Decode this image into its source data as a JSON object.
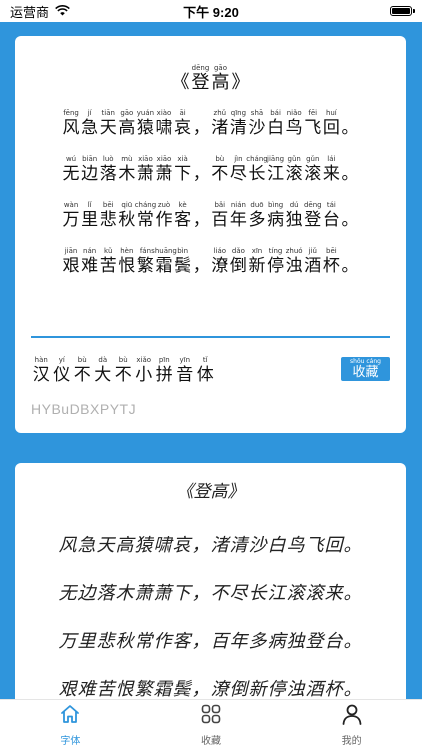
{
  "status_bar": {
    "carrier": "运营商",
    "time": "下午 9:20",
    "battery_level": 0.9
  },
  "poem": {
    "title": [
      {
        "py": "",
        "hz": "《"
      },
      {
        "py": "dēng",
        "hz": "登"
      },
      {
        "py": "gāo",
        "hz": "高"
      },
      {
        "py": "",
        "hz": "》"
      }
    ],
    "lines": [
      [
        {
          "py": "fēng",
          "hz": "风"
        },
        {
          "py": "jí",
          "hz": "急"
        },
        {
          "py": "tiān",
          "hz": "天"
        },
        {
          "py": "gāo",
          "hz": "高"
        },
        {
          "py": "yuán",
          "hz": "猿"
        },
        {
          "py": "xiào",
          "hz": "啸"
        },
        {
          "py": "āi",
          "hz": "哀"
        },
        {
          "py": "",
          "hz": "，"
        },
        {
          "py": "zhǔ",
          "hz": "渚"
        },
        {
          "py": "qīng",
          "hz": "清"
        },
        {
          "py": "shā",
          "hz": "沙"
        },
        {
          "py": "bái",
          "hz": "白"
        },
        {
          "py": "niǎo",
          "hz": "鸟"
        },
        {
          "py": "fēi",
          "hz": "飞"
        },
        {
          "py": "huí",
          "hz": "回"
        },
        {
          "py": "",
          "hz": "。"
        }
      ],
      [
        {
          "py": "wú",
          "hz": "无"
        },
        {
          "py": "biān",
          "hz": "边"
        },
        {
          "py": "luò",
          "hz": "落"
        },
        {
          "py": "mù",
          "hz": "木"
        },
        {
          "py": "xiāo",
          "hz": "萧"
        },
        {
          "py": "xiāo",
          "hz": "萧"
        },
        {
          "py": "xià",
          "hz": "下"
        },
        {
          "py": "",
          "hz": "，"
        },
        {
          "py": "bù",
          "hz": "不"
        },
        {
          "py": "jìn",
          "hz": "尽"
        },
        {
          "py": "cháng",
          "hz": "长"
        },
        {
          "py": "jiāng",
          "hz": "江"
        },
        {
          "py": "gǔn",
          "hz": "滚"
        },
        {
          "py": "gǔn",
          "hz": "滚"
        },
        {
          "py": "lái",
          "hz": "来"
        },
        {
          "py": "",
          "hz": "。"
        }
      ],
      [
        {
          "py": "wàn",
          "hz": "万"
        },
        {
          "py": "lǐ",
          "hz": "里"
        },
        {
          "py": "bēi",
          "hz": "悲"
        },
        {
          "py": "qiū",
          "hz": "秋"
        },
        {
          "py": "cháng",
          "hz": "常"
        },
        {
          "py": "zuò",
          "hz": "作"
        },
        {
          "py": "kè",
          "hz": "客"
        },
        {
          "py": "",
          "hz": "，"
        },
        {
          "py": "bǎi",
          "hz": "百"
        },
        {
          "py": "nián",
          "hz": "年"
        },
        {
          "py": "duō",
          "hz": "多"
        },
        {
          "py": "bìng",
          "hz": "病"
        },
        {
          "py": "dú",
          "hz": "独"
        },
        {
          "py": "dēng",
          "hz": "登"
        },
        {
          "py": "tái",
          "hz": "台"
        },
        {
          "py": "",
          "hz": "。"
        }
      ],
      [
        {
          "py": "jiān",
          "hz": "艰"
        },
        {
          "py": "nán",
          "hz": "难"
        },
        {
          "py": "kǔ",
          "hz": "苦"
        },
        {
          "py": "hèn",
          "hz": "恨"
        },
        {
          "py": "fán",
          "hz": "繁"
        },
        {
          "py": "shuāng",
          "hz": "霜"
        },
        {
          "py": "bìn",
          "hz": "鬓"
        },
        {
          "py": "",
          "hz": "，"
        },
        {
          "py": "liáo",
          "hz": "潦"
        },
        {
          "py": "dǎo",
          "hz": "倒"
        },
        {
          "py": "xīn",
          "hz": "新"
        },
        {
          "py": "tíng",
          "hz": "停"
        },
        {
          "py": "zhuó",
          "hz": "浊"
        },
        {
          "py": "jiǔ",
          "hz": "酒"
        },
        {
          "py": "bēi",
          "hz": "杯"
        },
        {
          "py": "",
          "hz": "。"
        }
      ]
    ]
  },
  "font_info": {
    "name": [
      {
        "py": "hàn",
        "hz": "汉"
      },
      {
        "py": "yí",
        "hz": "仪"
      },
      {
        "py": "bù",
        "hz": "不"
      },
      {
        "py": "dà",
        "hz": "大"
      },
      {
        "py": "bù",
        "hz": "不"
      },
      {
        "py": "xiǎo",
        "hz": "小"
      },
      {
        "py": "pīn",
        "hz": "拼"
      },
      {
        "py": "yīn",
        "hz": "音"
      },
      {
        "py": "tǐ",
        "hz": "体"
      }
    ],
    "code": "HYBuDBXPYTJ",
    "collect_pinyin": "shōu cáng",
    "collect_label": "收藏"
  },
  "preview": {
    "title": "《登高》",
    "lines": [
      "风急天高猿啸哀，渚清沙白鸟飞回。",
      "无边落木萧萧下，不尽长江滚滚来。",
      "万里悲秋常作客，百年多病独登台。",
      "艰难苦恨繁霜鬓，潦倒新停浊酒杯。"
    ]
  },
  "tabs": [
    {
      "label": "字体",
      "icon": "home-icon",
      "active": true
    },
    {
      "label": "收藏",
      "icon": "grid-icon",
      "active": false
    },
    {
      "label": "我的",
      "icon": "person-icon",
      "active": false
    }
  ],
  "colors": {
    "accent": "#2f95dc",
    "background": "#2f95dc",
    "muted_text": "#b0b0b0"
  }
}
